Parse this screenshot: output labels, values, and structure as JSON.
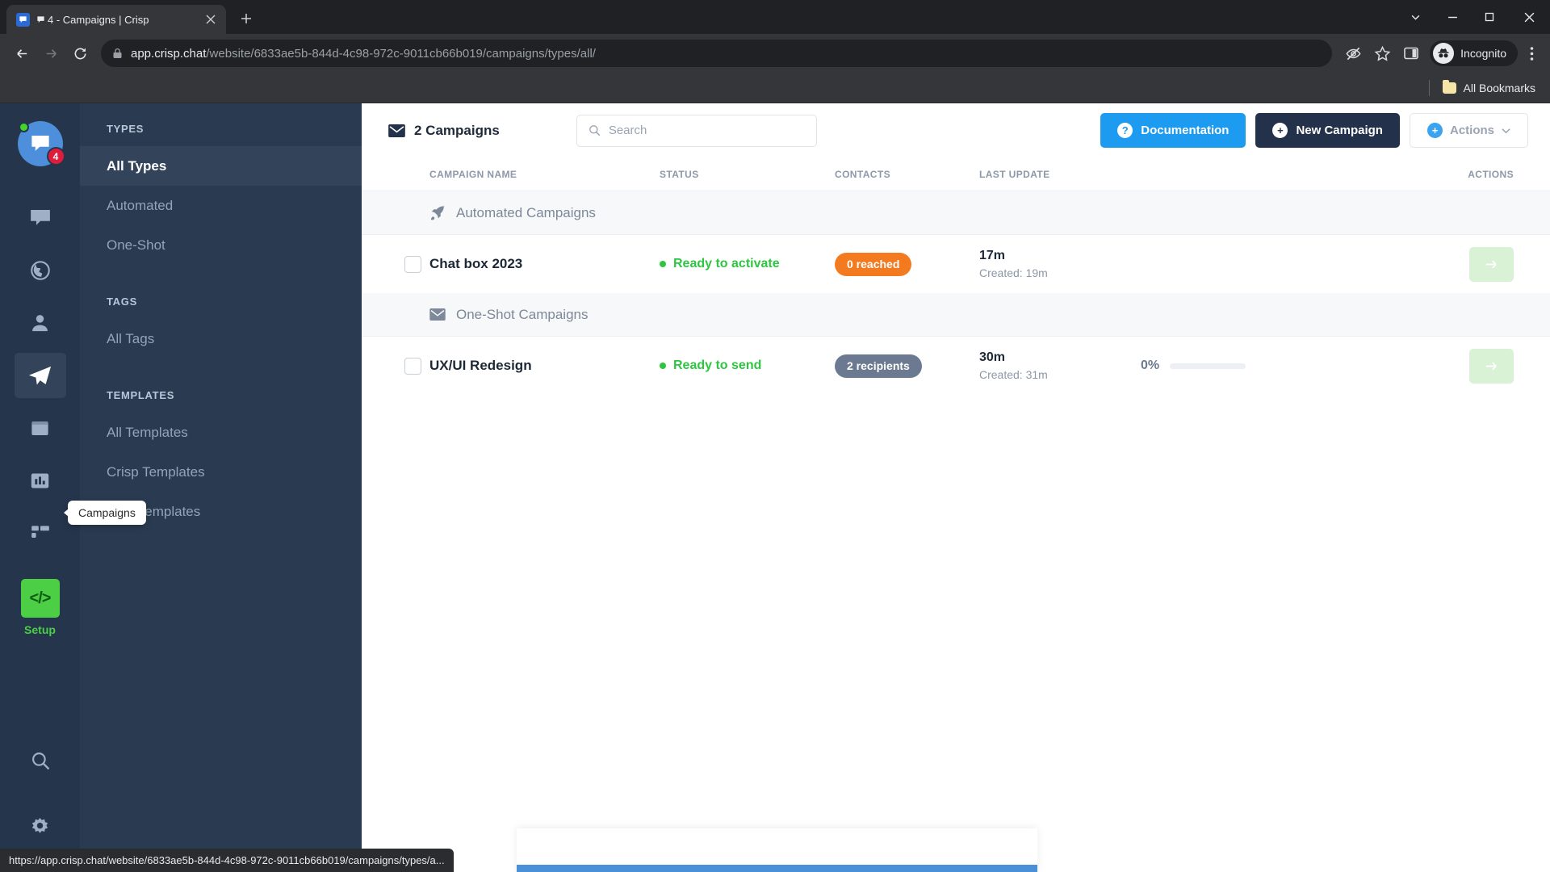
{
  "browser": {
    "tab": {
      "title": "4 - Campaigns | Crisp",
      "favicon": "crisp-chat-icon",
      "close": "×"
    },
    "new_tab_label": "+",
    "window_controls": [
      "minimize-list",
      "minimize",
      "maximize",
      "close"
    ],
    "nav": {
      "back": "back-arrow-icon",
      "forward": "forward-arrow-icon",
      "reload": "reload-icon"
    },
    "omnibox": {
      "lock": "lock-icon",
      "url_domain": "app.crisp.chat",
      "url_path": "/website/6833ae5b-844d-4c98-972c-9011cb66b019/campaigns/types/all/"
    },
    "toolbar_icons": [
      "eye-crossed-icon",
      "star-icon",
      "side-panel-icon"
    ],
    "profile": {
      "label": "Incognito",
      "icon": "incognito-icon"
    },
    "menu": "kebab-menu-icon",
    "bookmarks": {
      "label": "All Bookmarks",
      "icon": "folder-icon"
    },
    "status_url": "https://app.crisp.chat/website/6833ae5b-844d-4c98-972c-9011cb66b019/campaigns/types/a..."
  },
  "rail": {
    "avatar": {
      "badge": "4",
      "presence": "online",
      "icon": "crisp-avatar-icon"
    },
    "items": [
      {
        "name": "inbox",
        "icon": "chat-bubble-icon",
        "active": false
      },
      {
        "name": "visitors",
        "icon": "globe-icon",
        "active": false
      },
      {
        "name": "contacts",
        "icon": "person-icon",
        "active": false
      },
      {
        "name": "campaigns",
        "icon": "paper-plane-icon",
        "active": true
      },
      {
        "name": "helpdesk",
        "icon": "book-icon",
        "active": false
      },
      {
        "name": "analytics",
        "icon": "bar-chart-icon",
        "active": false
      },
      {
        "name": "plugins",
        "icon": "grid-icon",
        "active": false
      }
    ],
    "setup": {
      "label": "Setup",
      "icon": "code-brackets-icon"
    },
    "bottom": [
      {
        "name": "search",
        "icon": "search-icon"
      },
      {
        "name": "settings",
        "icon": "gear-icon"
      }
    ],
    "tooltip": "Campaigns"
  },
  "subnav": {
    "sections": [
      {
        "header": "TYPES",
        "items": [
          {
            "label": "All Types",
            "active": true
          },
          {
            "label": "Automated",
            "active": false
          },
          {
            "label": "One-Shot",
            "active": false
          }
        ]
      },
      {
        "header": "TAGS",
        "items": [
          {
            "label": "All Tags",
            "active": false
          }
        ]
      },
      {
        "header": "TEMPLATES",
        "items": [
          {
            "label": "All Templates",
            "active": false
          },
          {
            "label": "Crisp Templates",
            "active": false
          },
          {
            "label": "Your Templates",
            "active": false
          }
        ]
      }
    ]
  },
  "main": {
    "title": "2 Campaigns",
    "title_icon": "envelope-icon",
    "search": {
      "placeholder": "Search",
      "value": "",
      "icon": "search-icon"
    },
    "buttons": {
      "documentation": "Documentation",
      "new_campaign": "New Campaign",
      "actions": "Actions"
    },
    "columns": {
      "name": "CAMPAIGN NAME",
      "status": "STATUS",
      "contacts": "CONTACTS",
      "last_update": "LAST UPDATE",
      "actions": "ACTIONS"
    },
    "groups": [
      {
        "label": "Automated Campaigns",
        "icon": "rocket-icon",
        "rows": [
          {
            "name": "Chat box 2023",
            "status": "Ready to activate",
            "status_color": "#2ec641",
            "contacts_pill": "0 reached",
            "pill_color": "#f47a20",
            "last_update": "17m",
            "created": "Created: 19m",
            "progress_pct": "",
            "action_icon": "arrow-right-icon"
          }
        ]
      },
      {
        "label": "One-Shot Campaigns",
        "icon": "envelope-icon",
        "rows": [
          {
            "name": "UX/UI Redesign",
            "status": "Ready to send",
            "status_color": "#2ec641",
            "contacts_pill": "2 recipients",
            "pill_color": "#6b7a90",
            "last_update": "30m",
            "created": "Created: 31m",
            "progress_pct": "0%",
            "action_icon": "arrow-right-icon"
          }
        ]
      }
    ]
  }
}
